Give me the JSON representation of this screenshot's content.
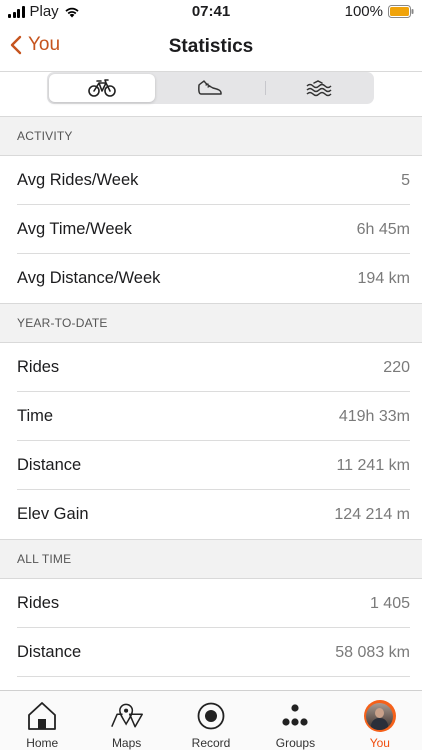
{
  "status_bar": {
    "carrier": "Play",
    "time": "07:41",
    "battery": "100%"
  },
  "nav": {
    "back_label": "You",
    "title": "Statistics"
  },
  "segments": [
    {
      "icon": "bike-icon",
      "active": true
    },
    {
      "icon": "shoe-icon",
      "active": false
    },
    {
      "icon": "swim-icon",
      "active": false
    }
  ],
  "sections": {
    "activity": {
      "header": "ACTIVITY",
      "rows": [
        {
          "label": "Avg Rides/Week",
          "value": "5"
        },
        {
          "label": "Avg Time/Week",
          "value": "6h 45m"
        },
        {
          "label": "Avg Distance/Week",
          "value": "194 km"
        }
      ]
    },
    "ytd": {
      "header": "YEAR-TO-DATE",
      "rows": [
        {
          "label": "Rides",
          "value": "220"
        },
        {
          "label": "Time",
          "value": "419h 33m"
        },
        {
          "label": "Distance",
          "value": "11 241 km"
        },
        {
          "label": "Elev Gain",
          "value": "124 214 m"
        }
      ]
    },
    "all_time": {
      "header": "ALL TIME",
      "rows": [
        {
          "label": "Rides",
          "value": "1 405"
        },
        {
          "label": "Distance",
          "value": "58 083 km"
        }
      ]
    }
  },
  "tabs": [
    {
      "label": "Home",
      "icon": "home-icon"
    },
    {
      "label": "Maps",
      "icon": "map-icon"
    },
    {
      "label": "Record",
      "icon": "record-icon"
    },
    {
      "label": "Groups",
      "icon": "groups-icon"
    },
    {
      "label": "You",
      "icon": "avatar",
      "active": true
    }
  ],
  "colors": {
    "accent": "#c6541e",
    "active_tab": "#f04e0f",
    "section_bg": "#f2f2f2"
  }
}
